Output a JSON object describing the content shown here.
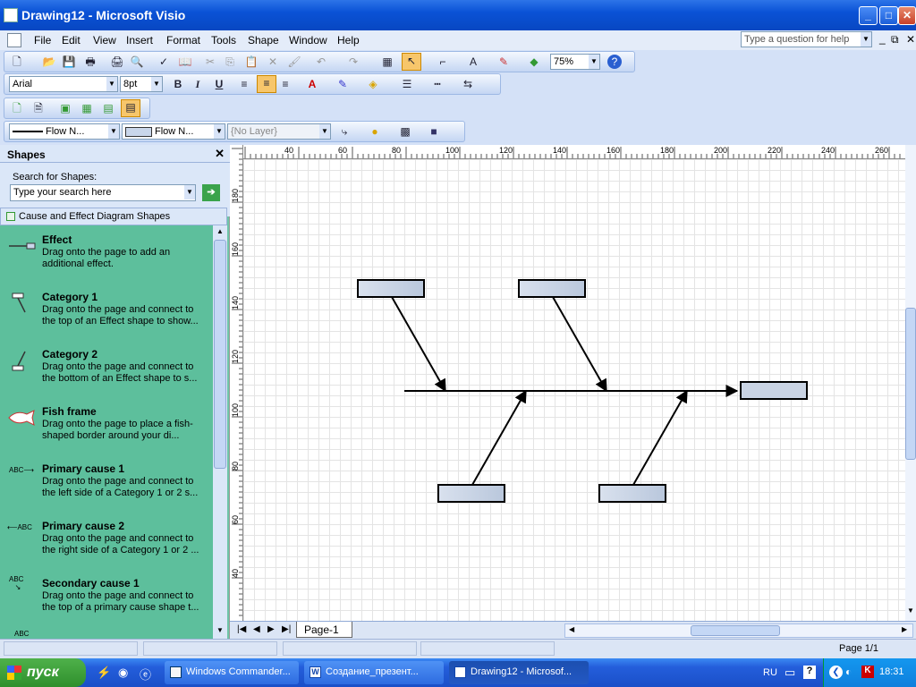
{
  "window": {
    "title": "Drawing12 - Microsoft Visio"
  },
  "menu": {
    "items": [
      "File",
      "Edit",
      "View",
      "Insert",
      "Format",
      "Tools",
      "Shape",
      "Window",
      "Help"
    ],
    "help_placeholder": "Type a question for help"
  },
  "toolbar": {
    "zoom": "75%",
    "font": "Arial",
    "font_size": "8pt",
    "bold": "B",
    "italic": "I",
    "underline": "U",
    "line_style": "Flow N...",
    "fill_style": "Flow N...",
    "layer": "{No Layer}"
  },
  "shapes_panel": {
    "title": "Shapes",
    "search_label": "Search for Shapes:",
    "search_placeholder": "Type your search here",
    "stencil": "Cause and Effect Diagram Shapes",
    "items": [
      {
        "name": "Effect",
        "desc": "Drag onto the page to add an additional effect."
      },
      {
        "name": "Category 1",
        "desc": "Drag onto the page and connect to the top of an Effect shape to show..."
      },
      {
        "name": "Category 2",
        "desc": "Drag onto the page and connect to the bottom of an Effect shape to s..."
      },
      {
        "name": "Fish frame",
        "desc": "Drag onto the page to place a fish-shaped border around your di..."
      },
      {
        "name": "Primary cause 1",
        "desc": "Drag onto the page and connect to the left side of a Category 1 or 2 s..."
      },
      {
        "name": "Primary cause 2",
        "desc": "Drag onto the page and connect to the right side of a Category 1 or 2 ..."
      },
      {
        "name": "Secondary cause 1",
        "desc": "Drag onto the page and connect to the top of a primary cause shape t..."
      }
    ],
    "abc": "ABC"
  },
  "ruler": {
    "h": [
      "40",
      "60",
      "80",
      "100",
      "120",
      "140",
      "160",
      "180",
      "200",
      "220",
      "240",
      "260"
    ],
    "v": [
      "180",
      "160",
      "140",
      "120",
      "100",
      "80",
      "60",
      "40"
    ]
  },
  "page_tab": "Page-1",
  "status": {
    "page": "Page 1/1"
  },
  "taskbar": {
    "start": "пуск",
    "tasks": [
      "Windows Commander...",
      "Создание_презент...",
      "Drawing12 - Microsof..."
    ],
    "lang": "RU",
    "clock": "18:31"
  }
}
